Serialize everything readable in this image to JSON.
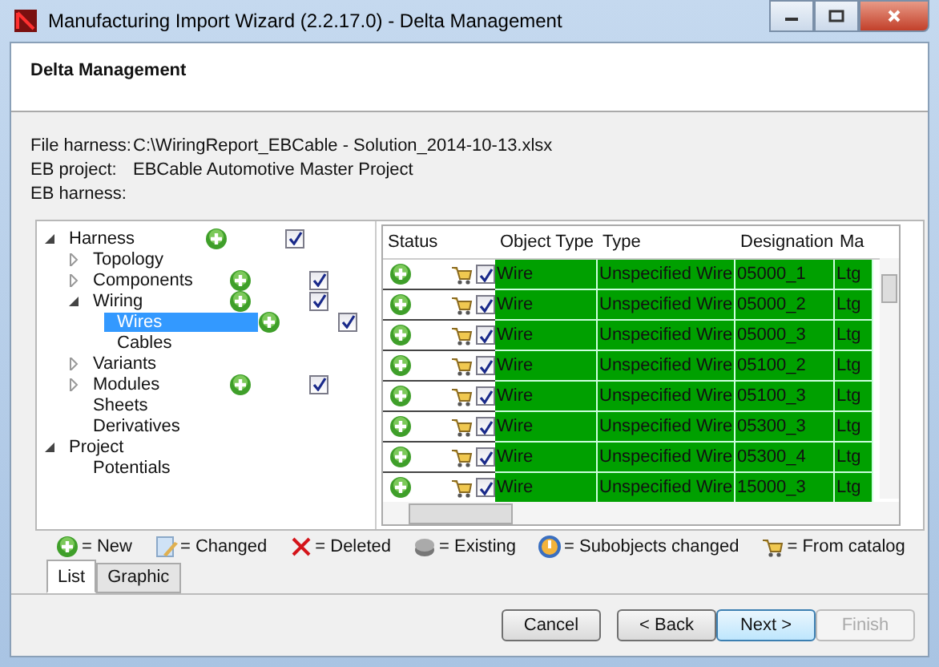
{
  "window": {
    "title": "Manufacturing Import Wizard (2.2.17.0) - Delta Management"
  },
  "header": {
    "title": "Delta Management"
  },
  "info": [
    {
      "label": "File harness:",
      "value": "C:\\WiringReport_EBCable - Solution_2014-10-13.xlsx"
    },
    {
      "label": "EB project:",
      "value": "EBCable Automotive Master Project"
    },
    {
      "label": "EB harness:"
    }
  ],
  "tree": [
    {
      "label": "Harness",
      "expanded": true,
      "new": true,
      "checked": true,
      "selected": false,
      "children": [
        {
          "label": "Topology",
          "expanded": false,
          "selected": false
        },
        {
          "label": "Components",
          "expanded": false,
          "new": true,
          "checked": true,
          "selected": false
        },
        {
          "label": "Wiring",
          "expanded": true,
          "new": true,
          "checked": true,
          "selected": false,
          "children": [
            {
              "label": "Wires",
              "new": true,
              "checked": true,
              "selected": true
            },
            {
              "label": "Cables",
              "selected": false
            }
          ]
        },
        {
          "label": "Variants",
          "expanded": false,
          "selected": false
        },
        {
          "label": "Modules",
          "expanded": false,
          "new": true,
          "checked": true,
          "selected": false
        },
        {
          "label": "Sheets",
          "selected": false
        },
        {
          "label": "Derivatives",
          "selected": false
        }
      ]
    },
    {
      "label": "Project",
      "expanded": true,
      "selected": false,
      "children": [
        {
          "label": "Potentials",
          "selected": false
        }
      ]
    }
  ],
  "table": {
    "columns": [
      "Status",
      "Object Type",
      "Type",
      "Designation",
      "Ma"
    ],
    "rows": [
      {
        "new": true,
        "from_catalog": true,
        "checked": true,
        "color": "#00a000",
        "object_type": "Wire",
        "type": "Unspecified Wire",
        "designation": "05000_1",
        "column_5": "Ltg"
      },
      {
        "new": true,
        "from_catalog": true,
        "checked": true,
        "color": "#00a000",
        "object_type": "Wire",
        "type": "Unspecified Wire",
        "designation": "05000_2",
        "column_5": "Ltg"
      },
      {
        "new": true,
        "from_catalog": true,
        "checked": true,
        "color": "#00a000",
        "object_type": "Wire",
        "type": "Unspecified Wire",
        "designation": "05000_3",
        "column_5": "Ltg"
      },
      {
        "new": true,
        "from_catalog": true,
        "checked": true,
        "color": "#00a000",
        "object_type": "Wire",
        "type": "Unspecified Wire",
        "designation": "05100_2",
        "column_5": "Ltg"
      },
      {
        "new": true,
        "from_catalog": true,
        "checked": true,
        "color": "#00a000",
        "object_type": "Wire",
        "type": "Unspecified Wire",
        "designation": "05100_3",
        "column_5": "Ltg"
      },
      {
        "new": true,
        "from_catalog": true,
        "checked": true,
        "color": "#00a000",
        "object_type": "Wire",
        "type": "Unspecified Wire",
        "designation": "05300_3",
        "column_5": "Ltg"
      },
      {
        "new": true,
        "from_catalog": true,
        "checked": true,
        "color": "#00a000",
        "object_type": "Wire",
        "type": "Unspecified Wire",
        "designation": "05300_4",
        "column_5": "Ltg"
      },
      {
        "new": true,
        "from_catalog": true,
        "checked": true,
        "color": "#00a000",
        "object_type": "Wire",
        "type": "Unspecified Wire",
        "designation": "15000_3",
        "column_5": "Ltg"
      }
    ]
  },
  "legend": [
    {
      "kind": "new",
      "label": "= New"
    },
    {
      "kind": "changed",
      "label": "= Changed"
    },
    {
      "kind": "deleted",
      "label": "= Deleted"
    },
    {
      "kind": "existing",
      "label": "= Existing"
    },
    {
      "kind": "subobjects",
      "label": "= Subobjects changed"
    },
    {
      "kind": "catalog",
      "label": "= From catalog"
    }
  ],
  "tabs": [
    {
      "label": "List",
      "selected": true
    },
    {
      "label": "Graphic",
      "selected": false
    }
  ],
  "buttons": [
    {
      "label": "Cancel",
      "default": false,
      "disabled": false
    },
    {
      "label": "< Back",
      "default": false,
      "disabled": false
    },
    {
      "label": "Next >",
      "default": true,
      "disabled": false
    },
    {
      "label": "Finish",
      "default": false,
      "disabled": true
    }
  ]
}
